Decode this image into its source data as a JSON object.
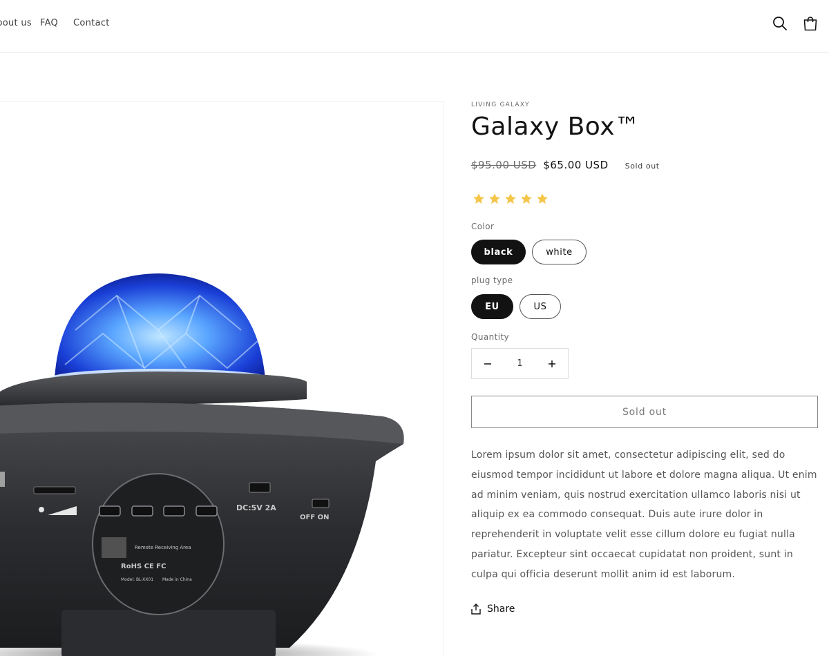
{
  "nav": {
    "items": [
      {
        "label": "About us"
      },
      {
        "label": "FAQ"
      },
      {
        "label": "Contact"
      }
    ],
    "icons": [
      "search-icon",
      "cart-icon"
    ]
  },
  "product": {
    "image_text": {
      "dc_label": "DC:5V 2A",
      "switch_label": "OFF ON",
      "remote_label": "Remote Receiving Area",
      "compliance": "RoHS CE FC",
      "model": "Model: BL-XX01",
      "origin": "Made in China"
    },
    "vendor": "LIVING GALAXY",
    "title": "Galaxy Box™",
    "price_compare": "$95.00 USD",
    "price_sale": "$65.00 USD",
    "badge": "Sold out",
    "rating": 5,
    "rating_max": 5,
    "star_color": "#f5c64a",
    "options": {
      "color": {
        "label": "Color",
        "values": [
          "black",
          "white"
        ],
        "selected": "black"
      },
      "plug": {
        "label": "plug type",
        "values": [
          "EU",
          "US"
        ],
        "selected": "EU"
      }
    },
    "quantity": {
      "label": "Quantity",
      "value": "1"
    },
    "cta": "Sold out",
    "description": "Lorem ipsum dolor sit amet, consectetur adipiscing elit, sed do eiusmod tempor incididunt ut labore et dolore magna aliqua. Ut enim ad minim veniam, quis nostrud exercitation ullamco laboris nisi ut aliquip ex ea commodo consequat. Duis aute irure dolor in reprehenderit in voluptate velit esse cillum dolore eu fugiat nulla pariatur. Excepteur sint occaecat cupidatat non proident, sunt in culpa qui officia deserunt mollit anim id est laborum.",
    "share_label": "Share"
  }
}
